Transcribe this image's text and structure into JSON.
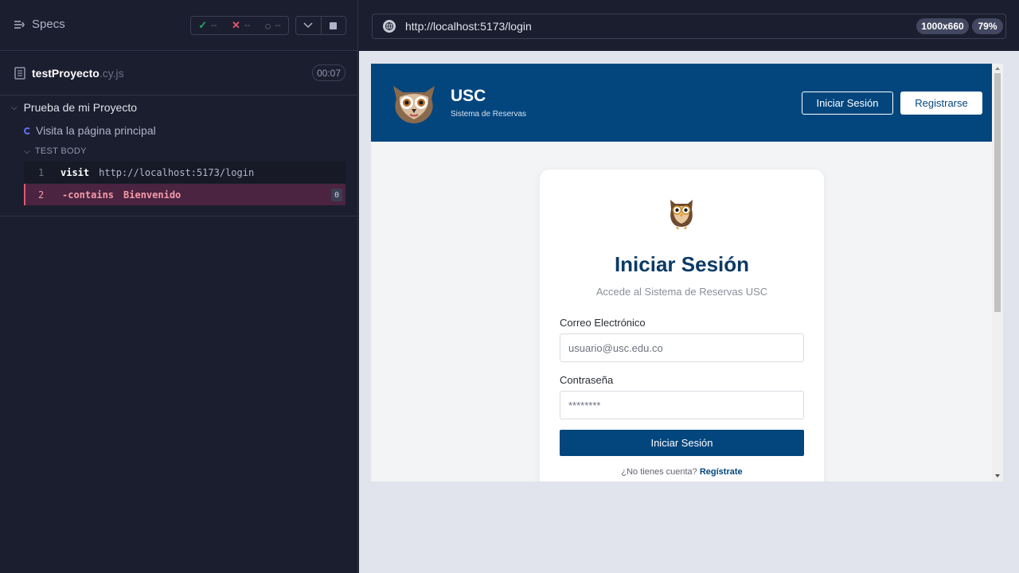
{
  "runner": {
    "specs_label": "Specs",
    "stats": {
      "passed": "--",
      "failed": "--",
      "pending": "--"
    },
    "spec": {
      "name": "testProyecto",
      "ext": ".cy.js",
      "duration": "00:07"
    },
    "suite": "Prueba de mi Proyecto",
    "test": "Visita la página principal",
    "body_label": "TEST BODY",
    "commands": [
      {
        "num": "1",
        "name": "visit",
        "arg": "http://localhost:5173/login"
      },
      {
        "num": "2",
        "name": "-contains",
        "arg": "Bienvenido",
        "badge": "0"
      }
    ]
  },
  "aut": {
    "url": "http://localhost:5173/login",
    "viewport": "1000x660",
    "zoom": "79%"
  },
  "app": {
    "brand_title": "USC",
    "brand_subtitle": "Sistema de Reservas",
    "nav_login": "Iniciar Sesión",
    "nav_register": "Registrarse",
    "card": {
      "title": "Iniciar Sesión",
      "subtitle": "Accede al Sistema de Reservas USC",
      "email_label": "Correo Electrónico",
      "email_placeholder": "usuario@usc.edu.co",
      "password_label": "Contraseña",
      "password_placeholder": "********",
      "submit": "Iniciar Sesión",
      "signup_prompt": "¿No tienes cuenta?",
      "signup_link": "Regístrate"
    }
  },
  "colors": {
    "primary": "#03467e",
    "runner_bg": "#1b1e2e",
    "failed": "#e45770",
    "passed": "#1fa971"
  }
}
